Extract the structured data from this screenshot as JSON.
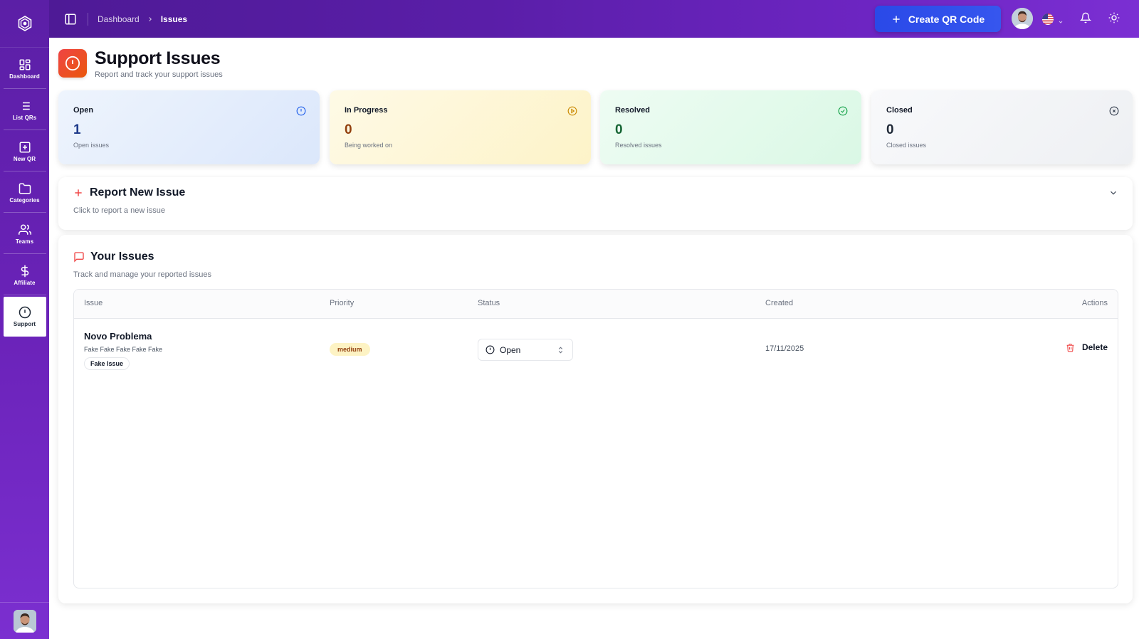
{
  "breadcrumb": {
    "parent": "Dashboard",
    "current": "Issues"
  },
  "header": {
    "create_button": "Create QR Code"
  },
  "sidebar": {
    "items": [
      {
        "label": "Dashboard",
        "icon": "dashboard-grid-icon"
      },
      {
        "label": "List QRs",
        "icon": "list-icon"
      },
      {
        "label": "New QR",
        "icon": "plus-square-icon"
      },
      {
        "label": "Categories",
        "icon": "folder-icon"
      },
      {
        "label": "Teams",
        "icon": "users-icon"
      },
      {
        "label": "Affiliate",
        "icon": "dollar-icon"
      },
      {
        "label": "Support",
        "icon": "alert-circle-icon",
        "active": true
      }
    ]
  },
  "page": {
    "title": "Support Issues",
    "subtitle": "Report and track your support issues"
  },
  "stats": [
    {
      "label": "Open",
      "value": "1",
      "desc": "Open issues",
      "color": "#1e3a8a"
    },
    {
      "label": "In Progress",
      "value": "0",
      "desc": "Being worked on",
      "color": "#92400e"
    },
    {
      "label": "Resolved",
      "value": "0",
      "desc": "Resolved issues",
      "color": "#166534"
    },
    {
      "label": "Closed",
      "value": "0",
      "desc": "Closed issues",
      "color": "#1f2937"
    }
  ],
  "report": {
    "title": "Report New Issue",
    "subtitle": "Click to report a new issue"
  },
  "issues": {
    "title": "Your Issues",
    "subtitle": "Track and manage your reported issues",
    "columns": [
      "Issue",
      "Priority",
      "Status",
      "Created",
      "Actions"
    ],
    "rows": [
      {
        "title": "Novo Problema",
        "description": "Fake Fake Fake Fake Fake",
        "tag": "Fake Issue",
        "priority": "medium",
        "status": "Open",
        "created": "17/11/2025",
        "action": "Delete"
      }
    ]
  },
  "colors": {
    "accent": "#3656ee",
    "brand_purple": "#5b1fa6",
    "danger": "#ef4444"
  }
}
